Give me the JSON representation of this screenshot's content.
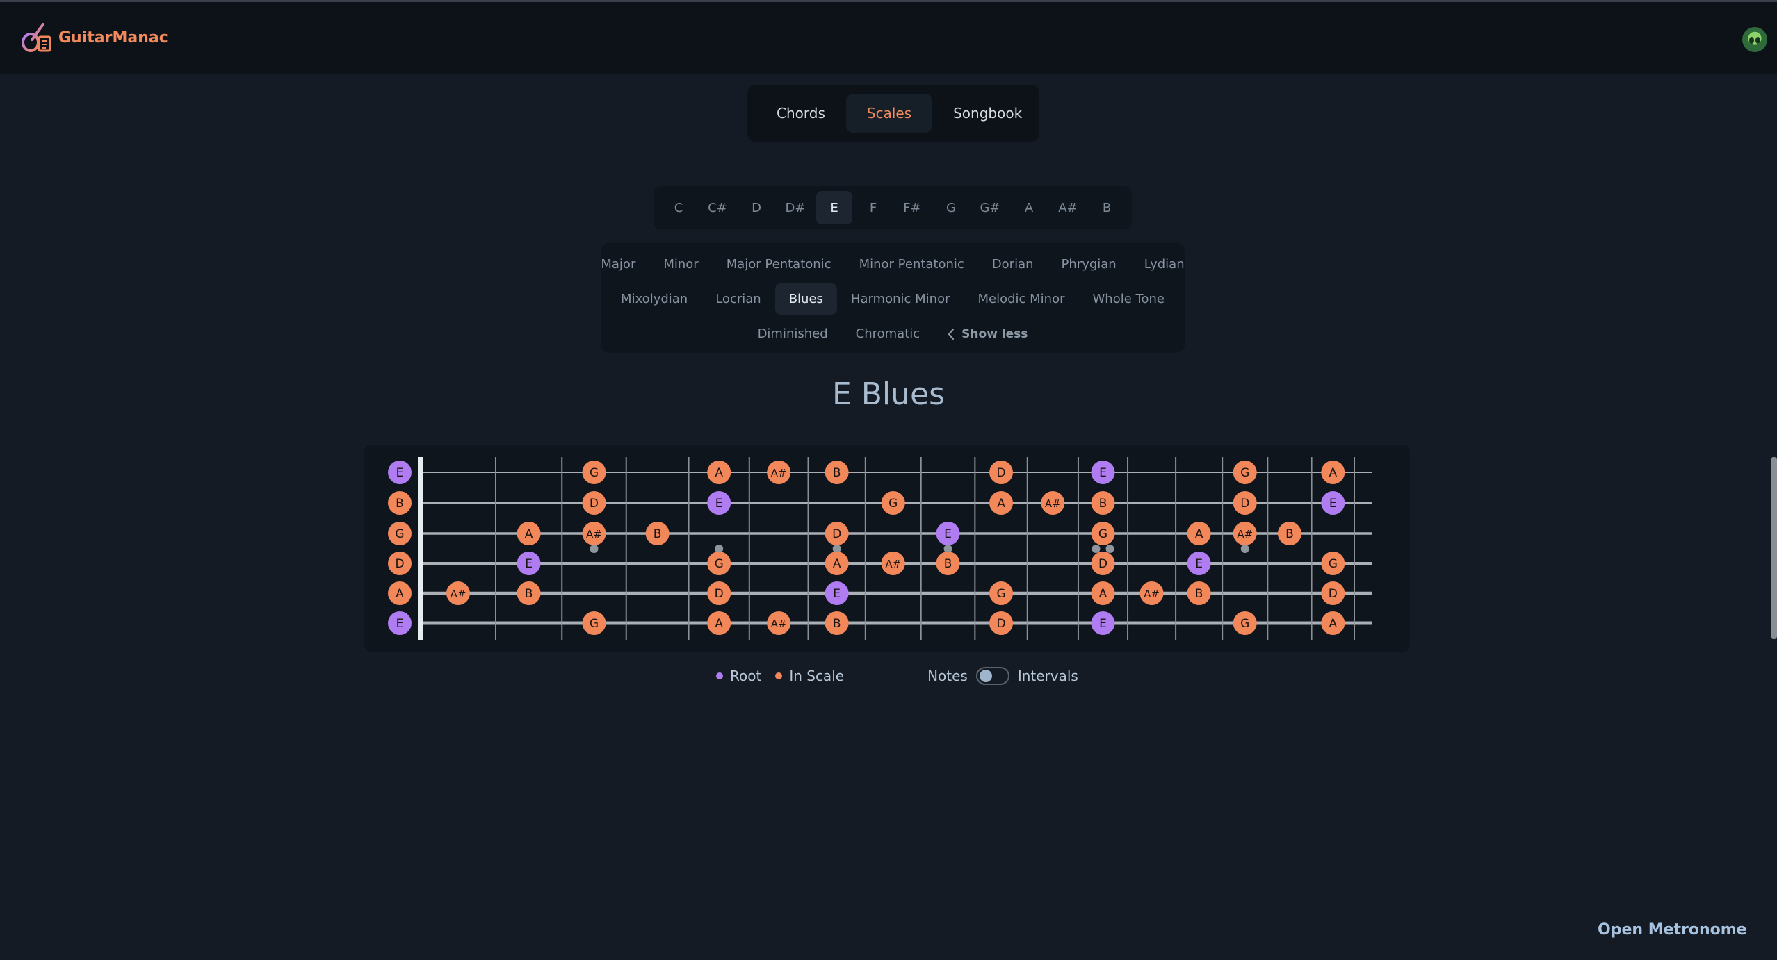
{
  "app": {
    "name": "GuitarManac"
  },
  "nav": {
    "tabs": [
      {
        "label": "Chords",
        "active": false
      },
      {
        "label": "Scales",
        "active": true
      },
      {
        "label": "Songbook",
        "active": false
      }
    ]
  },
  "keys": {
    "items": [
      "C",
      "C#",
      "D",
      "D#",
      "E",
      "F",
      "F#",
      "G",
      "G#",
      "A",
      "A#",
      "B"
    ],
    "selected": "E"
  },
  "scales": {
    "rows": [
      [
        "Major",
        "Minor",
        "Major Pentatonic",
        "Minor Pentatonic",
        "Dorian",
        "Phrygian",
        "Lydian"
      ],
      [
        "Mixolydian",
        "Locrian",
        "Blues",
        "Harmonic Minor",
        "Melodic Minor",
        "Whole Tone"
      ],
      [
        "Diminished",
        "Chromatic"
      ]
    ],
    "selected": "Blues",
    "show_less_label": "Show less"
  },
  "scale_title": "E Blues",
  "fretboard": {
    "strings_top_to_bottom": [
      [
        "E",
        "",
        "",
        "G",
        "",
        "A",
        "A#",
        "B",
        "",
        "",
        "D",
        "",
        "E",
        "",
        "",
        "G",
        "",
        "A"
      ],
      [
        "B",
        "",
        "",
        "D",
        "",
        "E",
        "",
        "",
        "G",
        "",
        "A",
        "A#",
        "B",
        "",
        "",
        "D",
        "",
        "E"
      ],
      [
        "G",
        "",
        "A",
        "A#",
        "B",
        "",
        "",
        "D",
        "",
        "E",
        "",
        "",
        "G",
        "",
        "A",
        "A#",
        "B",
        ""
      ],
      [
        "D",
        "",
        "E",
        "",
        "",
        "G",
        "",
        "A",
        "A#",
        "B",
        "",
        "",
        "D",
        "",
        "E",
        "",
        "",
        "G"
      ],
      [
        "A",
        "A#",
        "B",
        "",
        "",
        "D",
        "",
        "E",
        "",
        "",
        "G",
        "",
        "A",
        "A#",
        "B",
        "",
        "",
        "D"
      ],
      [
        "E",
        "",
        "",
        "G",
        "",
        "A",
        "A#",
        "B",
        "",
        "",
        "D",
        "",
        "E",
        "",
        "",
        "G",
        "",
        "A"
      ]
    ],
    "root": "E",
    "fret_count": 17,
    "colors": {
      "root": "#b07cf2",
      "in_scale": "#f2875a",
      "string": "#aab0b6",
      "fret": "#8a9096",
      "nut": "#e7ecf1",
      "inlay": "#8f969d"
    }
  },
  "legend": {
    "root_label": "Root",
    "in_scale_label": "In Scale",
    "notes_label": "Notes",
    "intervals_label": "Intervals",
    "mode": "notes"
  },
  "metronome_label": "Open Metronome"
}
